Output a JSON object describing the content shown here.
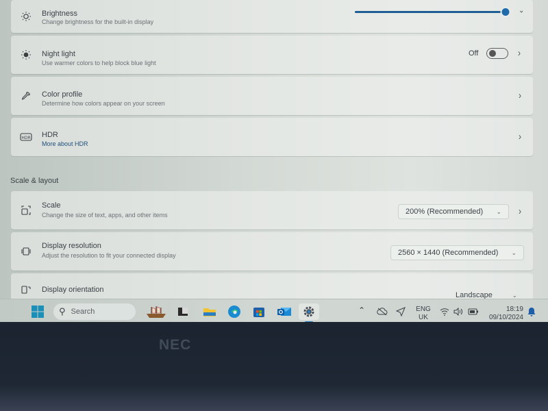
{
  "display_settings": {
    "brightness": {
      "title": "Brightness",
      "description": "Change brightness for the built-in display",
      "value_percent": 100
    },
    "night_light": {
      "title": "Night light",
      "description": "Use warmer colors to help block blue light",
      "state_label": "Off",
      "enabled": false
    },
    "color_profile": {
      "title": "Color profile",
      "description": "Determine how colors appear on your screen"
    },
    "hdr": {
      "title": "HDR",
      "link": "More about HDR"
    },
    "section_scale_layout": "Scale & layout",
    "scale": {
      "title": "Scale",
      "description": "Change the size of text, apps, and other items",
      "selected": "200% (Recommended)"
    },
    "resolution": {
      "title": "Display resolution",
      "description": "Adjust the resolution to fit your connected display",
      "selected": "2560 × 1440 (Recommended)"
    },
    "orientation": {
      "title": "Display orientation",
      "selected": "Landscape"
    }
  },
  "taskbar": {
    "search_placeholder": "Search",
    "pinned_apps": [
      "start",
      "ship-app",
      "terminal",
      "file-explorer",
      "edge",
      "microsoft-store",
      "outlook",
      "settings"
    ],
    "active_app": "settings",
    "language_line1": "ENG",
    "language_line2": "UK",
    "time": "18:19",
    "date": "09/10/2024"
  },
  "bezel": {
    "brand": "NEC"
  },
  "colors": {
    "accent": "#1e6aab",
    "link": "#1f4e7a"
  }
}
